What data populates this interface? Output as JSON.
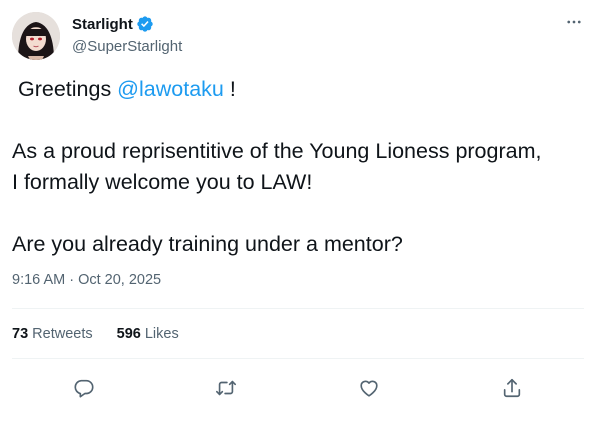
{
  "author": {
    "display_name": "Starlight",
    "handle": "@SuperStarlight",
    "verified": true,
    "avatar": "avatar-dark-hair-red-eyes"
  },
  "tweet": {
    "line1_prefix": "Greetings ",
    "mention": "@lawotaku",
    "line1_suffix": " !",
    "line2": "As a proud reprisentitive of the Young Lioness program,",
    "line3": "I formally welcome you to LAW!",
    "line4": "Are you already training under a mentor?"
  },
  "timestamp": "9:16 AM · Oct 20, 2025",
  "stats": {
    "retweets_count": "73",
    "retweets_label": "Retweets",
    "likes_count": "596",
    "likes_label": "Likes"
  },
  "icons": {
    "more": "more-horizontal-icon",
    "reply": "reply-icon",
    "retweet": "retweet-icon",
    "like": "heart-icon",
    "share": "share-icon",
    "verified": "verified-badge-icon"
  },
  "colors": {
    "accent": "#1d9bf0",
    "text": "#0f1419",
    "muted": "#536471",
    "divider": "#eff3f4"
  }
}
